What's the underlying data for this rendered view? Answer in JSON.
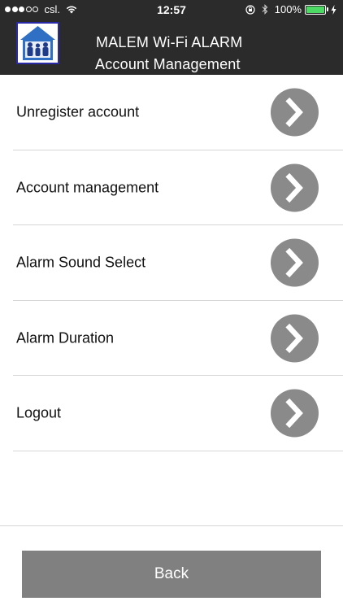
{
  "status_bar": {
    "carrier": "csl.",
    "time": "12:57",
    "battery_percent": "100%",
    "battery_level": 1.0,
    "signal_bars_filled": 3,
    "signal_bars_total": 5
  },
  "header": {
    "logo_icon": "house-family-icon",
    "title": "MALEM Wi-Fi ALARM",
    "subtitle": "Account Management",
    "background_color": "#2b2b2b"
  },
  "menu": {
    "items": [
      {
        "label": "Unregister account",
        "icon": "chevron-right-icon"
      },
      {
        "label": "Account management",
        "icon": "chevron-right-icon"
      },
      {
        "label": "Alarm Sound Select",
        "icon": "chevron-right-icon"
      },
      {
        "label": "Alarm Duration",
        "icon": "chevron-right-icon"
      },
      {
        "label": "Logout",
        "icon": "chevron-right-icon"
      }
    ],
    "chevron_color": "#8a8a8a"
  },
  "footer": {
    "back_label": "Back",
    "back_color": "#808080"
  }
}
